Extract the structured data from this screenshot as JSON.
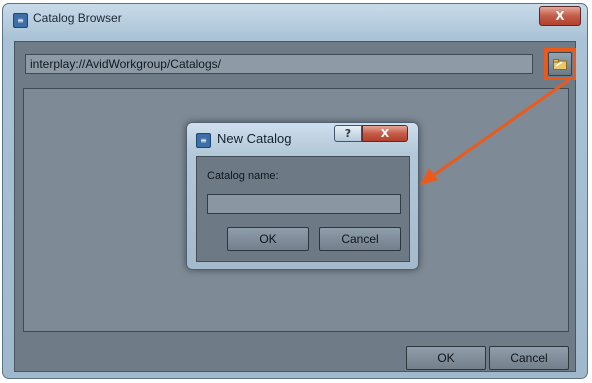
{
  "window": {
    "title": "Catalog Browser",
    "close_glyph": "X",
    "icon": "app-icon"
  },
  "path_bar": {
    "value": "interplay://AvidWorkgroup/Catalogs/",
    "browse_icon": "new-folder-icon"
  },
  "buttons": {
    "ok": "OK",
    "cancel": "Cancel"
  },
  "dialog": {
    "title": "New Catalog",
    "help_glyph": "?",
    "close_glyph": "X",
    "field_label": "Catalog name:",
    "field_value": "",
    "ok": "OK",
    "cancel": "Cancel"
  },
  "annotation": {
    "color": "#ea5a1c"
  }
}
